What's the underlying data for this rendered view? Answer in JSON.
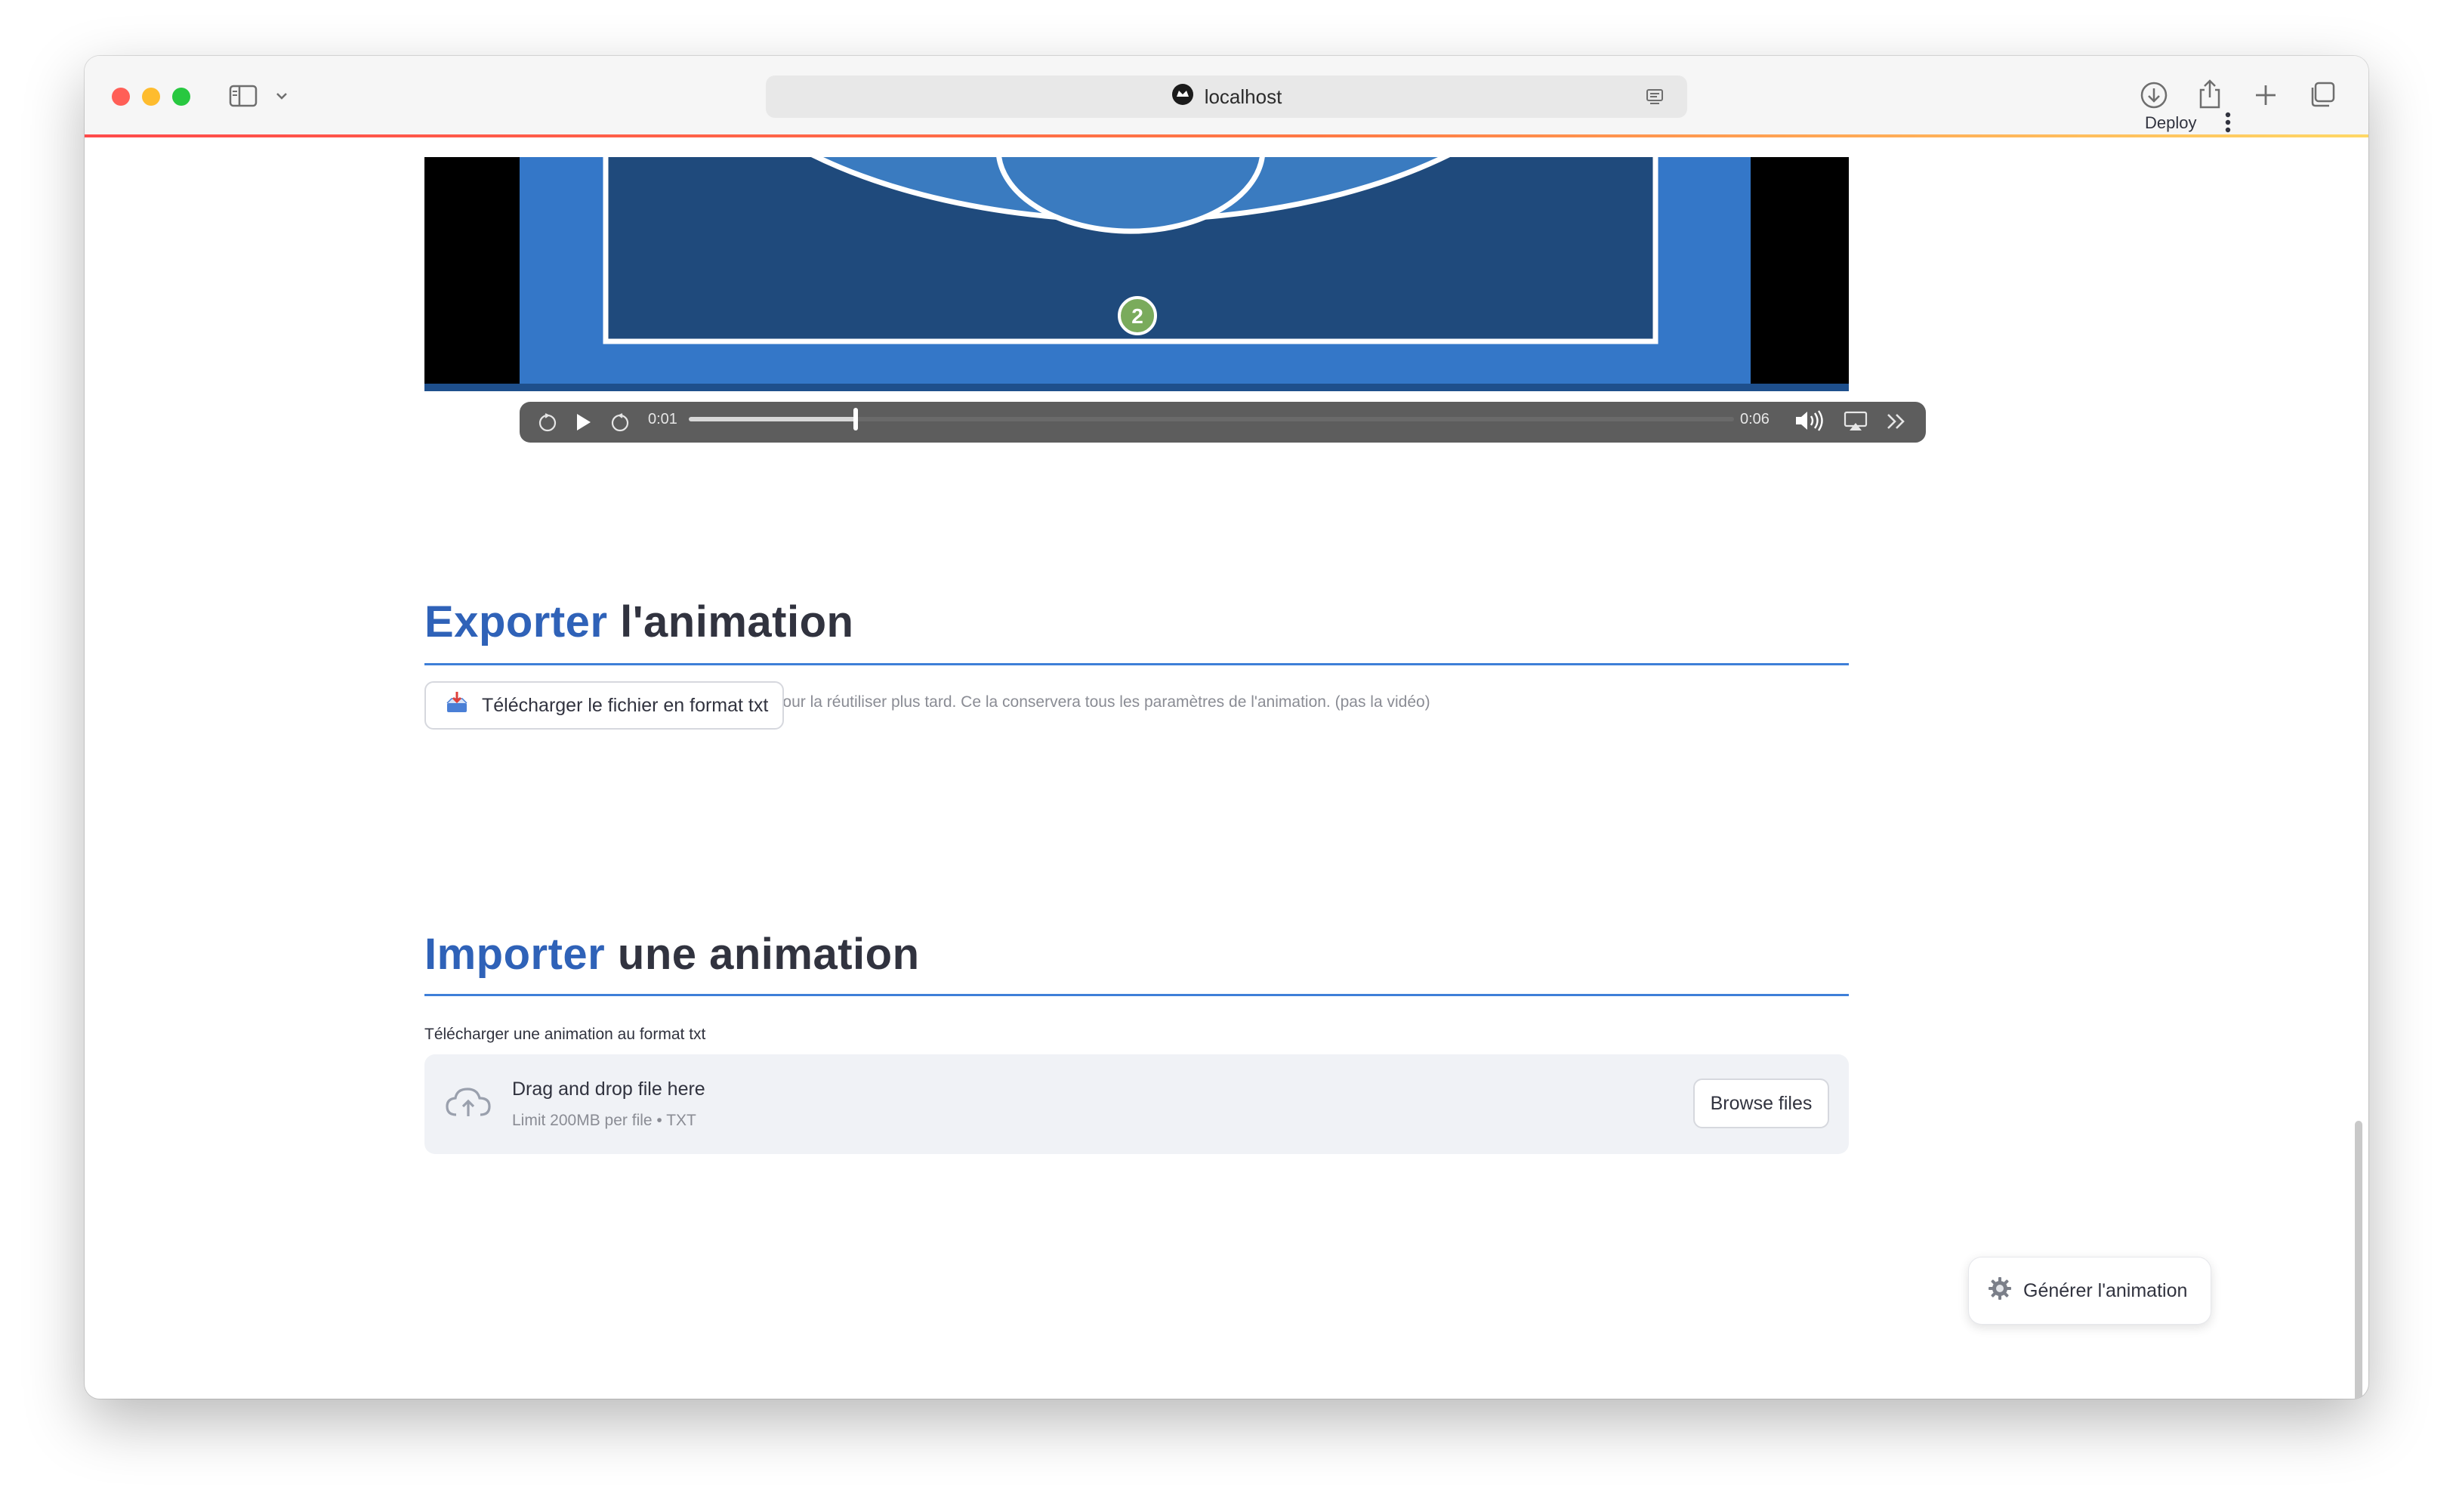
{
  "browser": {
    "url_text": "localhost",
    "icons": [
      "sidebar-icon",
      "chevron-down-icon",
      "site-favicon",
      "reader-icon",
      "download-icon",
      "share-icon",
      "new-tab-icon",
      "tabs-overview-icon"
    ],
    "traffic_colors": {
      "close": "#ff5f57",
      "minimize": "#febc2e",
      "zoom": "#28c840"
    }
  },
  "header": {
    "deploy_label": "Deploy",
    "menu_icon": "kebab-menu-icon"
  },
  "video": {
    "current_time": "0:01",
    "duration": "0:06",
    "progress_fraction": 0.16,
    "marker_label": "2",
    "icons": [
      "rewind-icon",
      "play-icon",
      "forward-icon",
      "volume-icon",
      "airplay-icon",
      "more-icon"
    ]
  },
  "export": {
    "title_accent": "Exporter",
    "title_rest": "l'animation",
    "description": "Vous pouvez ici exporter l'animation au format txt pour la réutiliser plus tard. Ce la conservera tous les paramètres de l'animation. (pas la vidéo)",
    "download_button_label": "Télécharger le fichier en format txt",
    "download_icon": "inbox-tray-icon"
  },
  "import": {
    "title_accent": "Importer",
    "title_rest": "une animation",
    "uploader_label": "Télécharger une animation au format txt",
    "dropzone_title": "Drag and drop file here",
    "dropzone_hint": "Limit 200MB per file • TXT",
    "browse_label": "Browse files",
    "upload_icon": "cloud-upload-icon"
  },
  "generate": {
    "button_label": "Générer l'animation",
    "icon": "gear-icon"
  },
  "colors": {
    "accent_blue": "#2f62b8",
    "rule_blue": "#3e7fd8",
    "court_dark": "#1f4a7c",
    "court_light": "#3a7bc0",
    "text": "#31333f"
  }
}
